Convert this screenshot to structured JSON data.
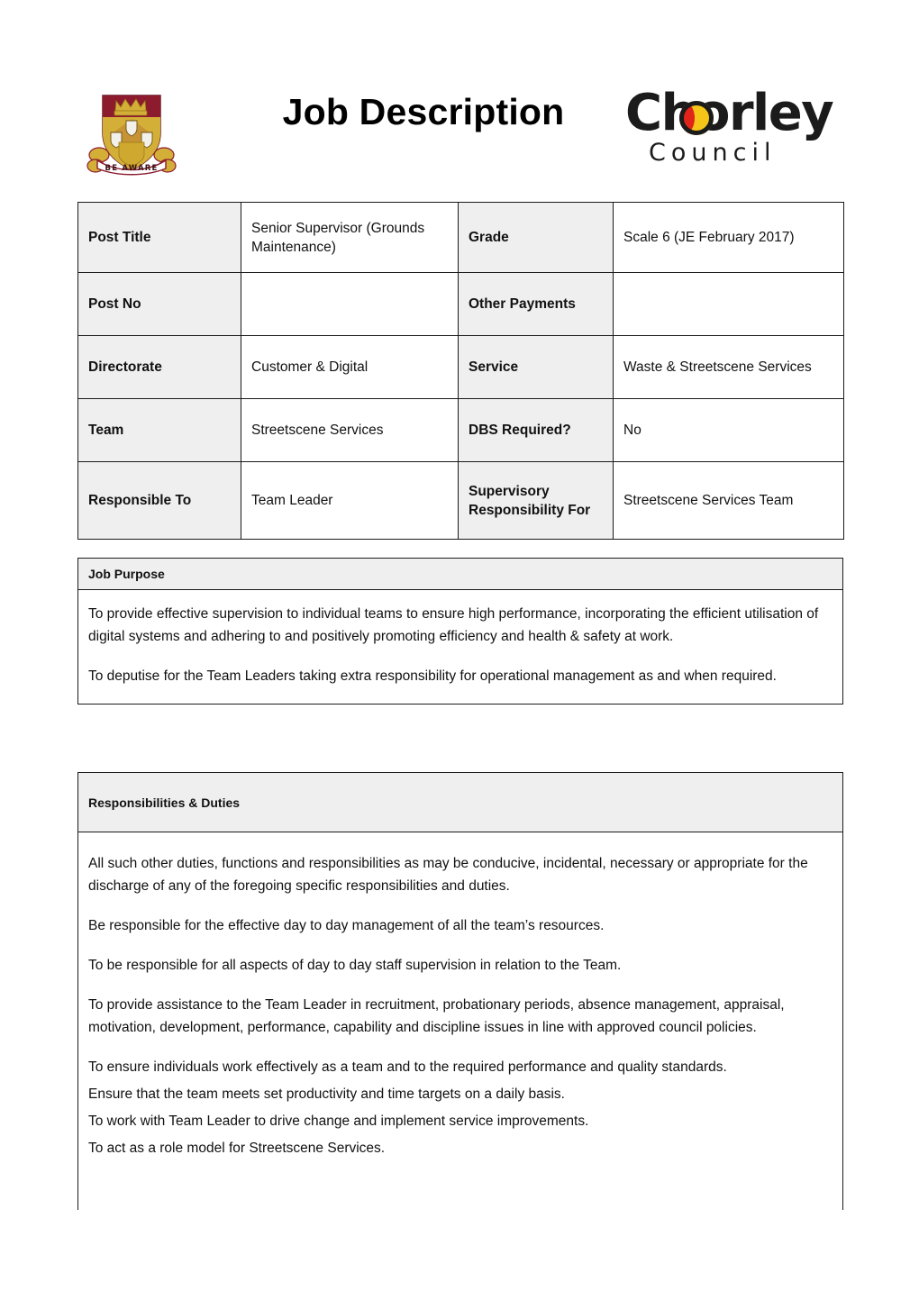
{
  "header": {
    "title": "Job Description",
    "crest_icon": "chorley-coat-of-arms-icon",
    "crest_motto": "BE AWARE",
    "brand_top": "Chorley",
    "brand_bottom": "Council",
    "colors": {
      "crest_maroon": "#8c1b2e",
      "crest_gold": "#d4af37",
      "brand_black": "#1b1b1b",
      "brand_yellow": "#f5c518",
      "brand_red": "#e2231a"
    }
  },
  "info_table": {
    "rows": [
      {
        "label_a": "Post Title",
        "value_a": "Senior Supervisor (Grounds Maintenance)",
        "label_b": "Grade",
        "value_b": "Scale 6 (JE February 2017)"
      },
      {
        "label_a": "Post No",
        "value_a": "",
        "label_b": "Other Payments",
        "value_b": ""
      },
      {
        "label_a": "Directorate",
        "value_a": "Customer & Digital",
        "label_b": "Service",
        "value_b": "Waste & Streetscene Services"
      },
      {
        "label_a": "Team",
        "value_a": "Streetscene Services",
        "label_b": "DBS Required?",
        "value_b": "No"
      },
      {
        "label_a": "Responsible To",
        "value_a": "Team Leader",
        "label_b": "Supervisory Responsibility For",
        "value_b": "Streetscene Services Team"
      }
    ]
  },
  "job_purpose": {
    "heading": "Job Purpose",
    "paragraphs": [
      "To provide effective supervision to individual teams to ensure high performance, incorporating the efficient utilisation of digital systems and adhering to and positively promoting efficiency and health & safety at work.",
      "To deputise for the Team Leaders taking extra responsibility for operational management as and when required."
    ]
  },
  "responsibilities": {
    "heading": "Responsibilities & Duties",
    "paragraphs": [
      "All such other duties, functions and responsibilities as may be conducive, incidental, necessary or appropriate for the discharge of any of the foregoing specific responsibilities and duties.",
      "Be responsible for the effective day to day management of all the team’s resources.",
      "To be responsible for all aspects of day to day staff supervision in relation to the Team.",
      " To provide assistance to the Team Leader in recruitment, probationary periods, absence management, appraisal, motivation, development, performance, capability and discipline issues in line with approved council policies.",
      "To ensure individuals work effectively as a team and to the required performance and quality standards.",
      "Ensure that the team meets set productivity and time targets on a daily basis.",
      "To work with Team Leader to drive change and implement service improvements.",
      "To act as a role model for Streetscene Services."
    ]
  }
}
